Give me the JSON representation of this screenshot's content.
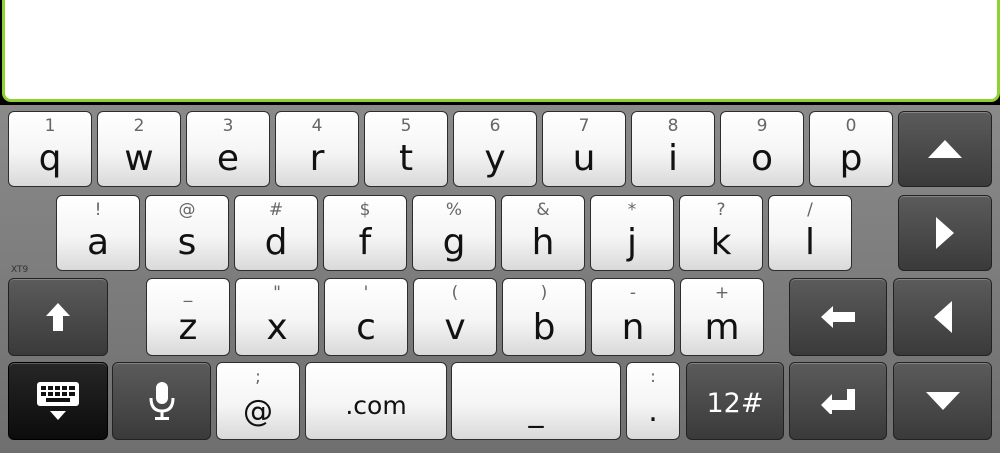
{
  "row1": [
    {
      "main": "q",
      "sec": "1"
    },
    {
      "main": "w",
      "sec": "2"
    },
    {
      "main": "e",
      "sec": "3"
    },
    {
      "main": "r",
      "sec": "4"
    },
    {
      "main": "t",
      "sec": "5"
    },
    {
      "main": "y",
      "sec": "6"
    },
    {
      "main": "u",
      "sec": "7"
    },
    {
      "main": "i",
      "sec": "8"
    },
    {
      "main": "o",
      "sec": "9"
    },
    {
      "main": "p",
      "sec": "0"
    }
  ],
  "row2": [
    {
      "main": "a",
      "sec": "!"
    },
    {
      "main": "s",
      "sec": "@"
    },
    {
      "main": "d",
      "sec": "#"
    },
    {
      "main": "f",
      "sec": "$"
    },
    {
      "main": "g",
      "sec": "%"
    },
    {
      "main": "h",
      "sec": "&"
    },
    {
      "main": "j",
      "sec": "*"
    },
    {
      "main": "k",
      "sec": "?"
    },
    {
      "main": "l",
      "sec": "/"
    }
  ],
  "row3": [
    {
      "main": "z",
      "sec": "_"
    },
    {
      "main": "x",
      "sec": "\""
    },
    {
      "main": "c",
      "sec": "'"
    },
    {
      "main": "v",
      "sec": "("
    },
    {
      "main": "b",
      "sec": ")"
    },
    {
      "main": "n",
      "sec": "-"
    },
    {
      "main": "m",
      "sec": "+"
    }
  ],
  "xt9_label": "XT9",
  "row4": {
    "at": {
      "main": "@",
      "sec": ";"
    },
    "com": ".com",
    "space": "_",
    "period": {
      "main": ".",
      "sec": ":"
    },
    "sym": "12#"
  },
  "icons": {
    "shift": "shift-up-arrow-icon",
    "keyboard": "keyboard-hide-icon",
    "mic": "microphone-icon",
    "up": "arrow-up-icon",
    "right": "arrow-right-icon",
    "left": "arrow-left-icon",
    "down": "arrow-down-icon",
    "backspace": "backspace-icon",
    "enter": "enter-icon"
  },
  "colors": {
    "accent": "#8fd132",
    "key_light": "#f5f5f5",
    "key_dark": "#3a3a3a"
  }
}
